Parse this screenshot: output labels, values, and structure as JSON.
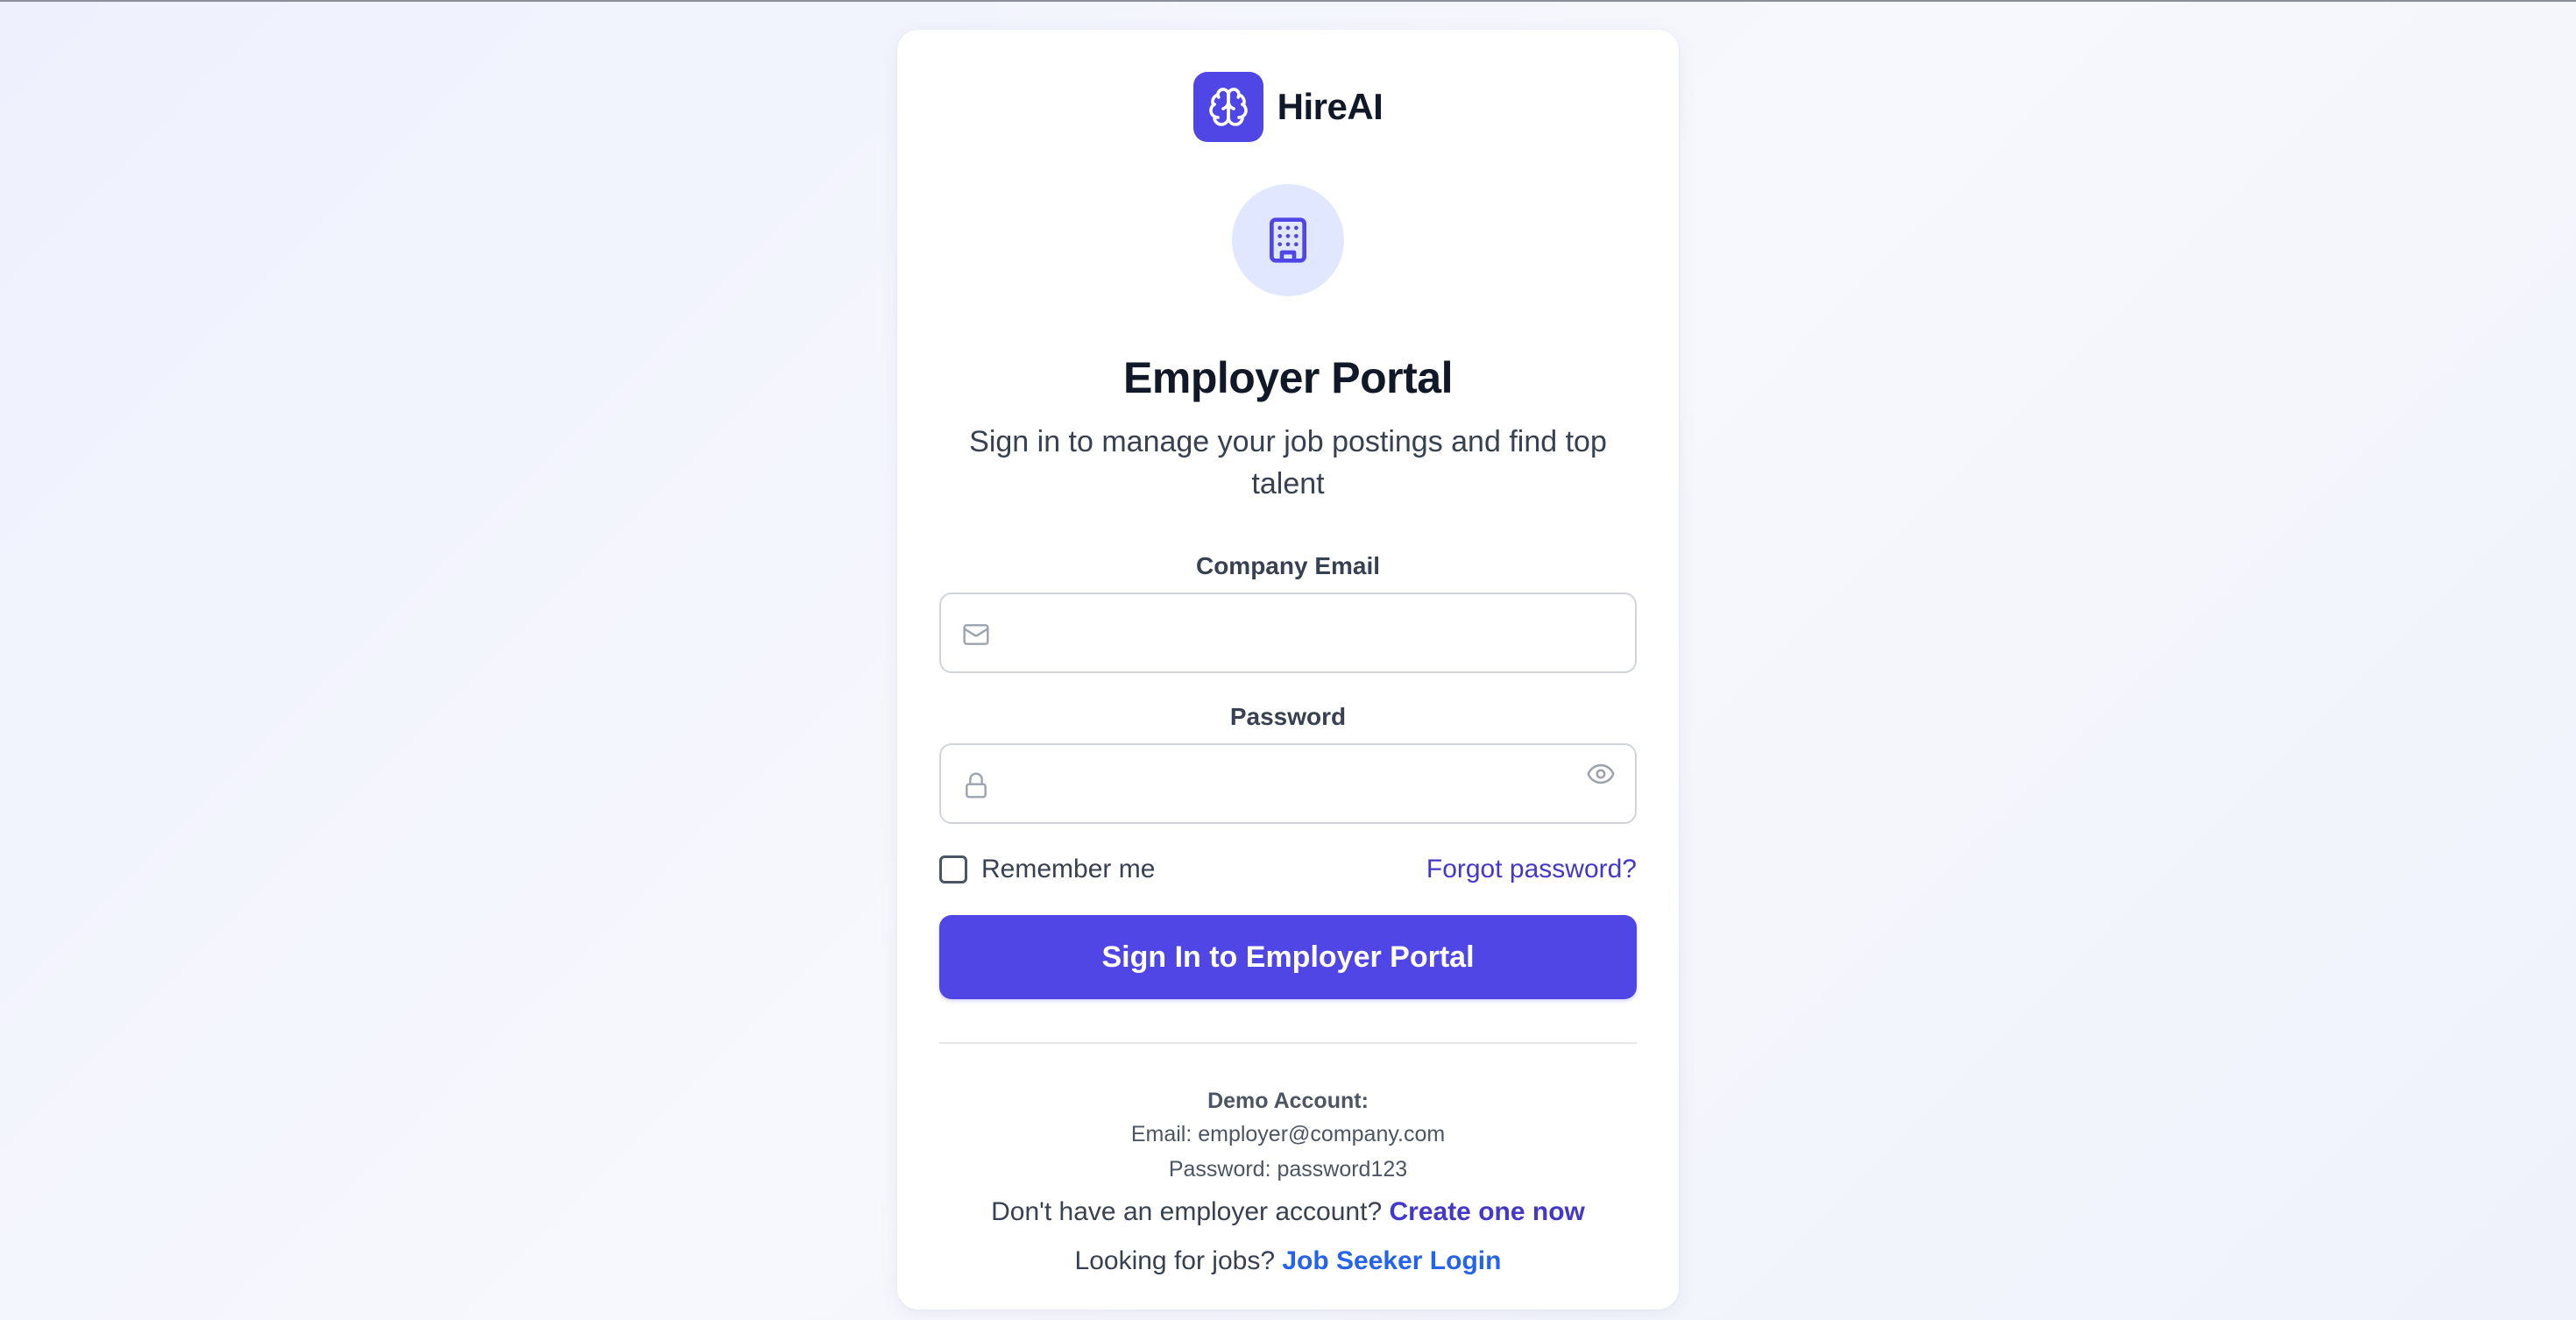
{
  "brand": {
    "name": "HireAI",
    "logo_icon": "brain-icon",
    "accent": "#4f46e5"
  },
  "header": {
    "portal_icon": "building-icon",
    "title": "Employer Portal",
    "subtitle": "Sign in to manage your job postings and find top talent"
  },
  "form": {
    "email": {
      "label": "Company Email",
      "value": "",
      "placeholder": "",
      "icon": "mail-icon"
    },
    "password": {
      "label": "Password",
      "value": "",
      "placeholder": "",
      "icon": "lock-icon",
      "toggle_icon": "eye-icon"
    },
    "remember_label": "Remember me",
    "remember_checked": false,
    "forgot_label": "Forgot password?",
    "submit_label": "Sign In to Employer Portal"
  },
  "demo": {
    "title": "Demo Account:",
    "email_line": "Email: employer@company.com",
    "password_line": "Password: password123"
  },
  "footer": {
    "signup_prompt": "Don't have an employer account?",
    "signup_link": "Create one now",
    "seeker_prompt": "Looking for jobs?",
    "seeker_link": "Job Seeker Login"
  },
  "colors": {
    "primary": "#4f46e5",
    "link_indigo": "#4338ca",
    "link_blue": "#2563eb",
    "icon_bg": "#e0e7ff"
  }
}
